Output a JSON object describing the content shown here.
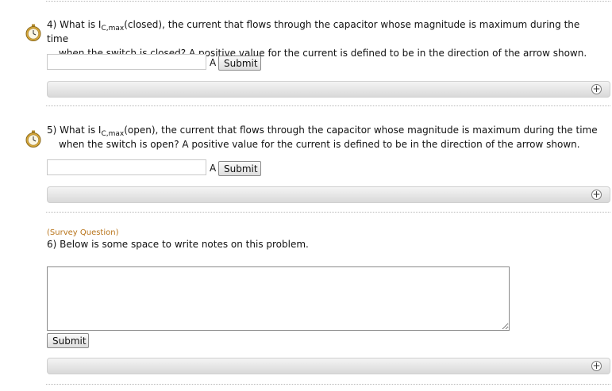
{
  "questions": [
    {
      "number": "4)",
      "prefix": "What is I",
      "subscript": "C,max",
      "suffix": "(closed), the current that flows through the capacitor whose magnitude is maximum during the time",
      "line2": "when the switch is closed? A positive value for the current is defined to be in the direction of the arrow shown.",
      "input_value": "",
      "unit": "A",
      "submit_label": "Submit",
      "icon": "stopwatch-icon",
      "expand_icon": "plus-icon"
    },
    {
      "number": "5)",
      "prefix": "What is I",
      "subscript": "C,max",
      "suffix": "(open), the current that flows through the capacitor whose magnitude is maximum during the time",
      "line2": "when the switch is open? A positive value for the current is defined to be in the direction of the arrow shown.",
      "input_value": "",
      "unit": "A",
      "submit_label": "Submit",
      "icon": "stopwatch-icon",
      "expand_icon": "plus-icon"
    }
  ],
  "survey": {
    "label": "(Survey Question)",
    "number": "6)",
    "text": "Below is some space to write notes on this problem.",
    "notes_value": "",
    "submit_label": "Submit",
    "expand_icon": "plus-icon"
  },
  "colors": {
    "survey_label": "#b8741a"
  }
}
